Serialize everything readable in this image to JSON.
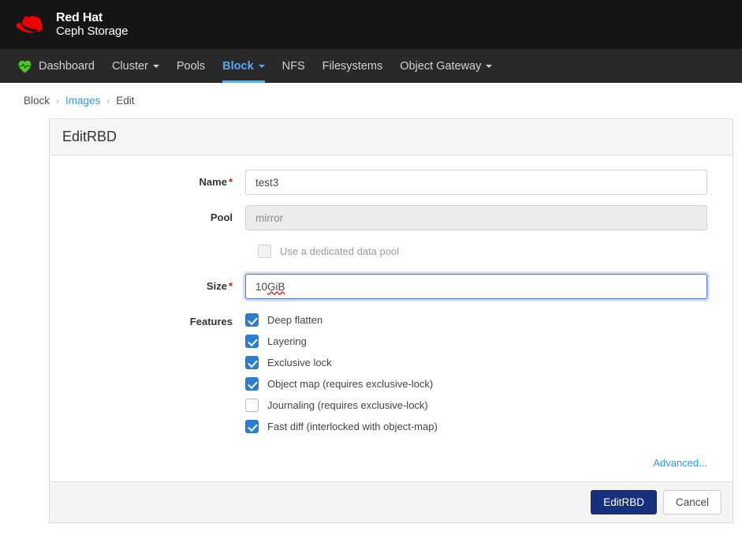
{
  "brand": {
    "logo_icon": "redhat-fedora-icon",
    "line1": "Red Hat",
    "line2": "Ceph Storage"
  },
  "nav": {
    "dashboard_icon": "ceph-heartbeat-icon",
    "items": [
      {
        "label": "Dashboard",
        "active": false,
        "caret": false,
        "icon": "ceph-heartbeat-icon"
      },
      {
        "label": "Cluster",
        "active": false,
        "caret": true
      },
      {
        "label": "Pools",
        "active": false,
        "caret": false
      },
      {
        "label": "Block",
        "active": true,
        "caret": true
      },
      {
        "label": "NFS",
        "active": false,
        "caret": false
      },
      {
        "label": "Filesystems",
        "active": false,
        "caret": false
      },
      {
        "label": "Object Gateway",
        "active": false,
        "caret": true
      }
    ]
  },
  "breadcrumb": {
    "items": [
      {
        "label": "Block",
        "link": false
      },
      {
        "label": "Images",
        "link": true
      },
      {
        "label": "Edit",
        "link": false
      }
    ],
    "separator": "›"
  },
  "card": {
    "title": "EditRBD",
    "form": {
      "name": {
        "label": "Name",
        "required_marker": "*",
        "value": "test3"
      },
      "pool": {
        "label": "Pool",
        "value": "mirror",
        "disabled": true
      },
      "dedicated_data_pool": {
        "label": "Use a dedicated data pool",
        "checked": false,
        "disabled": true
      },
      "size": {
        "label": "Size",
        "required_marker": "*",
        "value": "10 ",
        "value_spellchecked": "GiB",
        "focused": true
      },
      "features": {
        "label": "Features",
        "items": [
          {
            "label": "Deep flatten",
            "checked": true
          },
          {
            "label": "Layering",
            "checked": true
          },
          {
            "label": "Exclusive lock",
            "checked": true
          },
          {
            "label": "Object map (requires exclusive-lock)",
            "checked": true
          },
          {
            "label": "Journaling (requires exclusive-lock)",
            "checked": false
          },
          {
            "label": "Fast diff (interlocked with object-map)",
            "checked": true
          }
        ]
      },
      "advanced_link": "Advanced..."
    },
    "footer": {
      "submit_label": "EditRBD",
      "cancel_label": "Cancel"
    }
  },
  "colors": {
    "brand_red": "#ee0000",
    "brandbar_bg": "#151515",
    "navbar_bg": "#292929",
    "nav_active": "#5ba7f0",
    "link_blue": "#2b9af3",
    "checkbox_blue": "#2b7dd1",
    "primary_button": "#16307c",
    "required_red": "#c9190b",
    "focus_border": "#4a6fd8"
  }
}
